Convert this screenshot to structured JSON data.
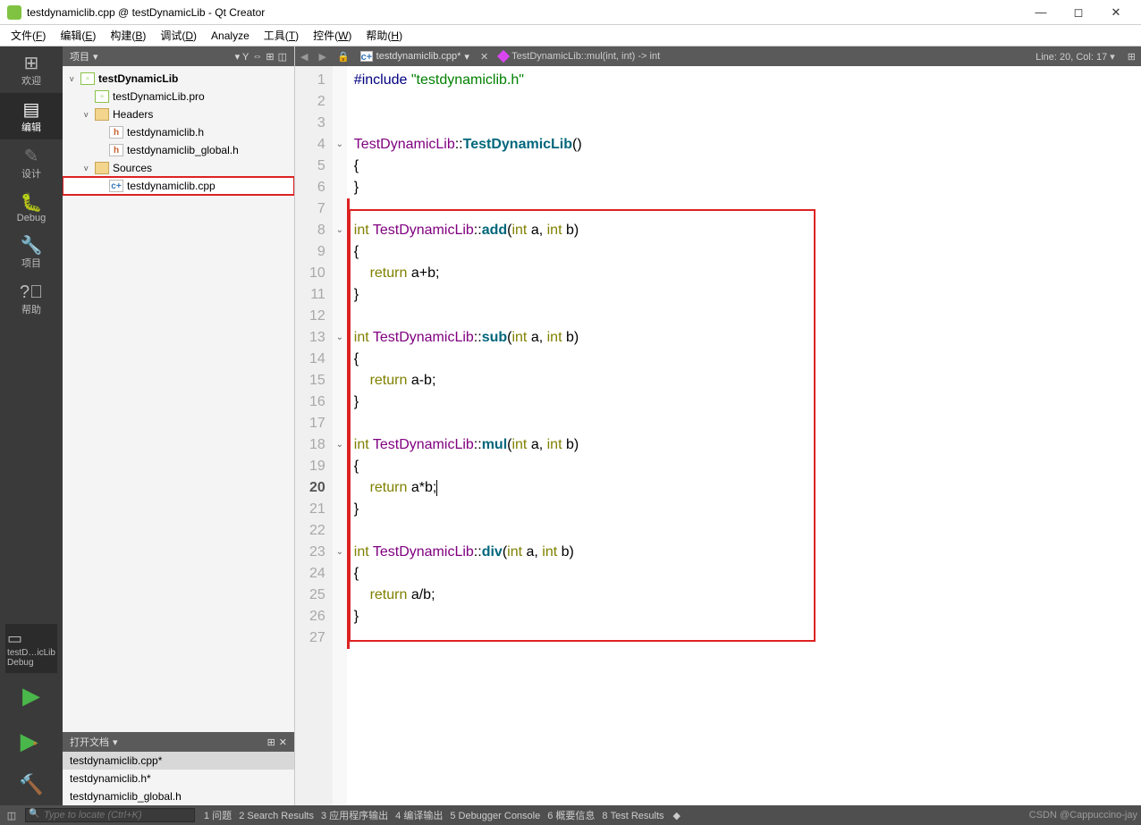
{
  "window": {
    "title": "testdynamiclib.cpp @ testDynamicLib - Qt Creator"
  },
  "menu": [
    "文件(F)",
    "编辑(E)",
    "构建(B)",
    "调试(D)",
    "Analyze",
    "工具(T)",
    "控件(W)",
    "帮助(H)"
  ],
  "iconbar": {
    "items": [
      {
        "label": "欢迎"
      },
      {
        "label": "编辑"
      },
      {
        "label": "设计"
      },
      {
        "label": "Debug"
      },
      {
        "label": "项目"
      },
      {
        "label": "帮助"
      }
    ],
    "kit": "testD…icLib",
    "mode": "Debug"
  },
  "project": {
    "title": "项目",
    "tree": [
      {
        "lvl": 0,
        "tw": "v",
        "ico": "pro",
        "label": "testDynamicLib",
        "bold": true
      },
      {
        "lvl": 1,
        "tw": "",
        "ico": "pro",
        "label": "testDynamicLib.pro"
      },
      {
        "lvl": 1,
        "tw": "v",
        "ico": "folderh",
        "label": "Headers"
      },
      {
        "lvl": 2,
        "tw": "",
        "ico": "h",
        "label": "testdynamiclib.h"
      },
      {
        "lvl": 2,
        "tw": "",
        "ico": "h",
        "label": "testdynamiclib_global.h"
      },
      {
        "lvl": 1,
        "tw": "v",
        "ico": "folder",
        "label": "Sources"
      },
      {
        "lvl": 2,
        "tw": "",
        "ico": "cpp",
        "label": "testdynamiclib.cpp",
        "sel": true
      }
    ]
  },
  "opendocs": {
    "title": "打开文档",
    "items": [
      {
        "label": "testdynamiclib.cpp*",
        "sel": true
      },
      {
        "label": "testdynamiclib.h*"
      },
      {
        "label": "testdynamiclib_global.h"
      }
    ]
  },
  "editor": {
    "file": "testdynamiclib.cpp*",
    "crumb": "TestDynamicLib::mul(int, int) -> int",
    "pos": "Line: 20, Col: 17",
    "lines": 27,
    "current": 20,
    "folds": [
      4,
      8,
      13,
      18,
      23
    ],
    "code": [
      {
        "n": 1,
        "h": "<span class='pp'>#include</span> <span class='str'>\"testdynamiclib.h\"</span>"
      },
      {
        "n": 2,
        "h": ""
      },
      {
        "n": 3,
        "h": ""
      },
      {
        "n": 4,
        "h": "<span class='cls'>TestDynamicLib</span>::<span class='fn'>TestDynamicLib</span>()"
      },
      {
        "n": 5,
        "h": "{"
      },
      {
        "n": 6,
        "h": "}"
      },
      {
        "n": 7,
        "h": ""
      },
      {
        "n": 8,
        "h": "<span class='kw'>int</span> <span class='cls'>TestDynamicLib</span>::<span class='fn'>add</span>(<span class='kw'>int</span> a, <span class='kw'>int</span> b)"
      },
      {
        "n": 9,
        "h": "{"
      },
      {
        "n": 10,
        "h": "    <span class='kw'>return</span> a+b;"
      },
      {
        "n": 11,
        "h": "}"
      },
      {
        "n": 12,
        "h": ""
      },
      {
        "n": 13,
        "h": "<span class='kw'>int</span> <span class='cls'>TestDynamicLib</span>::<span class='fn'>sub</span>(<span class='kw'>int</span> a, <span class='kw'>int</span> b)"
      },
      {
        "n": 14,
        "h": "{"
      },
      {
        "n": 15,
        "h": "    <span class='kw'>return</span> a-b;"
      },
      {
        "n": 16,
        "h": "}"
      },
      {
        "n": 17,
        "h": ""
      },
      {
        "n": 18,
        "h": "<span class='kw'>int</span> <span class='cls'>TestDynamicLib</span>::<span class='fn'>mul</span>(<span class='kw'>int</span> a, <span class='kw'>int</span> b)"
      },
      {
        "n": 19,
        "h": "{"
      },
      {
        "n": 20,
        "h": "    <span class='kw'>return</span> a*b;<span class='cursor'></span>"
      },
      {
        "n": 21,
        "h": "}"
      },
      {
        "n": 22,
        "h": ""
      },
      {
        "n": 23,
        "h": "<span class='kw'>int</span> <span class='cls'>TestDynamicLib</span>::<span class='fn'>div</span>(<span class='kw'>int</span> a, <span class='kw'>int</span> b)"
      },
      {
        "n": 24,
        "h": "{"
      },
      {
        "n": 25,
        "h": "    <span class='kw'>return</span> a/b;"
      },
      {
        "n": 26,
        "h": "}"
      },
      {
        "n": 27,
        "h": ""
      }
    ]
  },
  "status": {
    "locate_ph": "Type to locate (Ctrl+K)",
    "tabs": [
      "1 问题",
      "2 Search Results",
      "3 应用程序输出",
      "4 编译输出",
      "5 Debugger Console",
      "6 概要信息",
      "8 Test Results"
    ],
    "watermark": "CSDN @Cappuccino-jay"
  }
}
